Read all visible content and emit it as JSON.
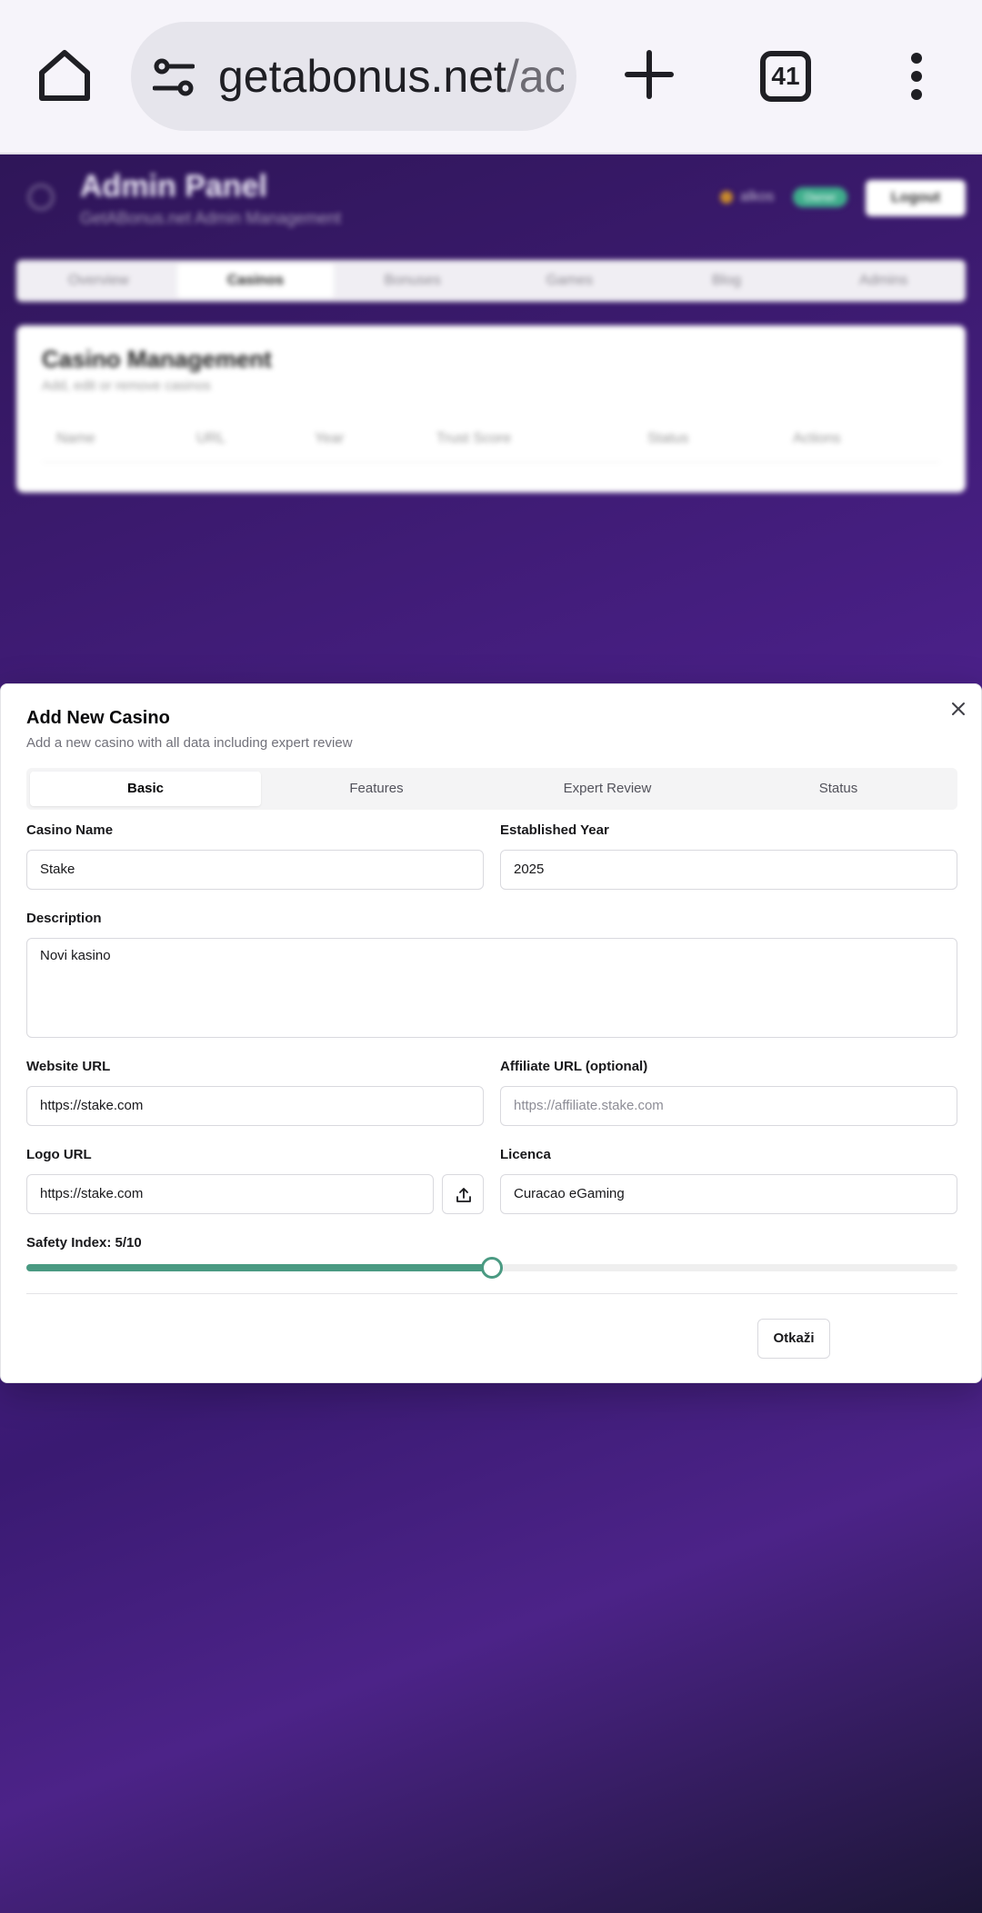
{
  "browser": {
    "url_host": "getabonus.net",
    "url_path": "/ac",
    "tab_count": "41",
    "icons": [
      "home-icon",
      "site-settings-icon",
      "new-tab-plus-icon",
      "tab-switcher-icon",
      "more-menu-icon"
    ]
  },
  "background_app": {
    "title": "Admin Panel",
    "subtitle": "GetABonus.net Admin Management",
    "user": "alkos",
    "role_badge": "Owner",
    "logout_label": "Logout",
    "nav_tabs": [
      {
        "label": "Overview"
      },
      {
        "label": "Casinos"
      },
      {
        "label": "Bonuses"
      },
      {
        "label": "Games"
      },
      {
        "label": "Blog"
      },
      {
        "label": "Admins"
      }
    ],
    "card_title": "Casino Management",
    "card_subtitle": "Add, edit or remove casinos",
    "table_columns": [
      "Name",
      "URL",
      "Year",
      "Trust Score",
      "Status",
      "Actions"
    ]
  },
  "modal": {
    "title": "Add New Casino",
    "description": "Add a new casino with all data including expert review",
    "tabs": [
      {
        "label": "Basic",
        "active": true
      },
      {
        "label": "Features",
        "active": false
      },
      {
        "label": "Expert Review",
        "active": false
      },
      {
        "label": "Status",
        "active": false
      }
    ],
    "fields": {
      "casino_name": {
        "label": "Casino Name",
        "value": "Stake"
      },
      "established_year": {
        "label": "Established Year",
        "value": "2025"
      },
      "description": {
        "label": "Description",
        "value": "Novi kasino"
      },
      "website_url": {
        "label": "Website URL",
        "value": "https://stake.com"
      },
      "affiliate_url": {
        "label": "Affiliate URL (optional)",
        "value": "",
        "placeholder": "https://affiliate.stake.com"
      },
      "logo_url": {
        "label": "Logo URL",
        "value": "https://stake.com"
      },
      "licence": {
        "label": "Licenca",
        "value": "Curacao eGaming"
      }
    },
    "safety_index": {
      "label": "Safety Index: 5/10",
      "value": 5,
      "max": 10
    },
    "cancel_label": "Otkaži",
    "accent_color": "#4a9a82"
  }
}
